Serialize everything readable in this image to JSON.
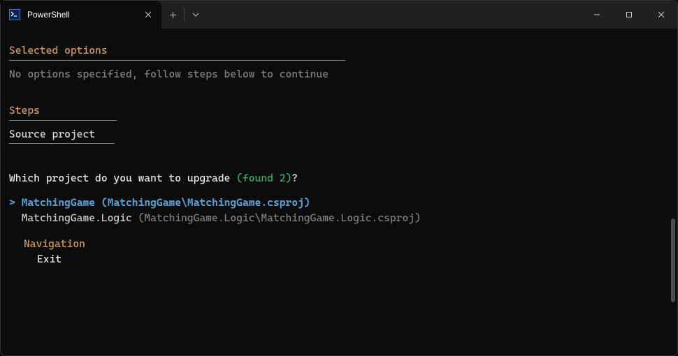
{
  "titlebar": {
    "tab_title": "PowerShell"
  },
  "terminal": {
    "selected_options_header": "Selected options",
    "options_text": "No options specified, follow steps below to continue",
    "steps_header": "Steps",
    "step_item": "Source project",
    "prompt_prefix": "Which project do you want to upgrade ",
    "found_text": "(found 2)",
    "prompt_suffix": "?",
    "options": [
      {
        "marker": ">",
        "name": "MatchingGame",
        "path": "(MatchingGame\\MatchingGame.csproj)",
        "selected": true
      },
      {
        "marker": " ",
        "name": "MatchingGame.Logic",
        "path": "(MatchingGame.Logic\\MatchingGame.Logic.csproj)",
        "selected": false
      }
    ],
    "nav_header": "Navigation",
    "nav_item": "Exit"
  }
}
